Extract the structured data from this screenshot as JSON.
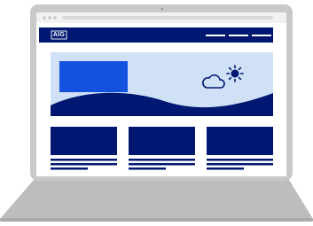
{
  "site": {
    "logo_text": "AIG"
  },
  "colors": {
    "laptop_frame": "#c9c9c9",
    "laptop_base": "#bdbdbd",
    "screen_bg": "#ffffff",
    "browser_bar": "#f1f1f1",
    "navy": "#001871",
    "hero_bg": "#cfe0f7",
    "hero_block": "#1352de",
    "weather_icon": "#001871"
  },
  "icons": {
    "weather": [
      "cloud-icon",
      "sun-icon"
    ]
  }
}
